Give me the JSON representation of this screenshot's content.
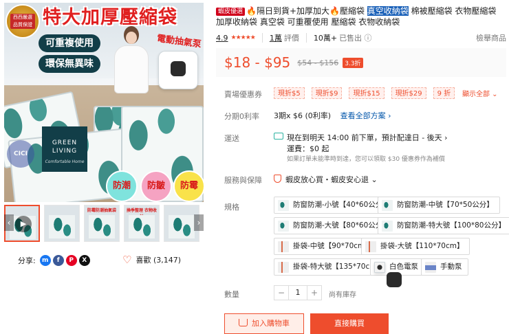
{
  "gallery": {
    "banner_title": "特大加厚壓縮袋",
    "seal_text": "西西嚴選 品質保證",
    "feature_pills": [
      "可重複使用",
      "環保無異味"
    ],
    "pump_tag": "電動抽氣泵",
    "card_title_1": "GREEN",
    "card_title_2": "LIVING",
    "card_script": "Comfortable Home",
    "circle_badges": [
      "防潮",
      "防皺",
      "防霉"
    ],
    "watermark": "CICI",
    "thumbnails": [
      {
        "caption": "",
        "video": true
      },
      {
        "caption": "",
        "video": false
      },
      {
        "caption": "防霉防潮抽氣袋",
        "video": false
      },
      {
        "caption": "換季整理 衣物收納",
        "video": false
      },
      {
        "caption": "",
        "video": false
      }
    ]
  },
  "share": {
    "label": "分享:",
    "icons": [
      "messenger-icon",
      "facebook-icon",
      "pinterest-icon",
      "x-icon"
    ]
  },
  "like": {
    "label": "喜歡 (3,147)"
  },
  "product": {
    "mall_tag": "蝦皮優選",
    "title_part1": "🔥隔日到貨+加厚加大🔥壓縮袋 ",
    "title_highlight": "真空收納袋",
    "title_part2": " 棉被壓縮袋 衣物壓縮袋 加厚收納袋 真空袋 可重覆使用 壓縮袋 衣物收納袋"
  },
  "stats": {
    "rating": "4.9",
    "stars": "★★★★★",
    "reviews_num": "1萬",
    "reviews_label": "評價",
    "sold_num": "10萬+",
    "sold_label": "已售出 ⓘ",
    "report": "檢舉商品"
  },
  "price": {
    "range": "$18 - $95",
    "original": "$54 - $156",
    "discount": "3.3折"
  },
  "coupons": {
    "label": "賣場優惠券",
    "items": [
      "現折$5",
      "現折$9",
      "現折$15",
      "現折$29",
      "9 折"
    ],
    "show_all": "顯示全部 ⌄"
  },
  "installment": {
    "label": "分期0利率",
    "text": "3期x $6 (0利率)",
    "link": "查看全部方案 ›"
  },
  "shipping": {
    "label": "運送",
    "line1": "現在到明天 14:00 前下單，預計配達日 - 後天 ›",
    "line2": "運費：$0 起",
    "line3": "如果訂單未能準時到達，您可以領取 $30 優惠券作為補償"
  },
  "guarantee": {
    "label": "服務與保障",
    "text": "蝦皮放心買・蝦皮安心退 ⌄"
  },
  "variants": {
    "label": "規格",
    "items": [
      "防窗防潮-小號【40*60公分】",
      "防窗防潮-中號【70*50公分】",
      "防窗防潮-大號【80*60公分】",
      "防窗防潮-特大號【100*80公分】",
      "掛袋-中號【90*70cm】",
      "掛袋-大號【110*70cm】",
      "掛袋-特大號【135*70cm】",
      "白色電泵",
      "手動泵"
    ]
  },
  "quantity": {
    "label": "數量",
    "minus": "−",
    "value": "1",
    "plus": "+",
    "stock": "尚有庫存"
  },
  "actions": {
    "add_to_cart": "加入購物車",
    "buy_now": "直接購買"
  },
  "colors": {
    "accent": "#ee4d2d",
    "mall_red": "#d0011b",
    "highlight_blue": "#1c62b9"
  }
}
